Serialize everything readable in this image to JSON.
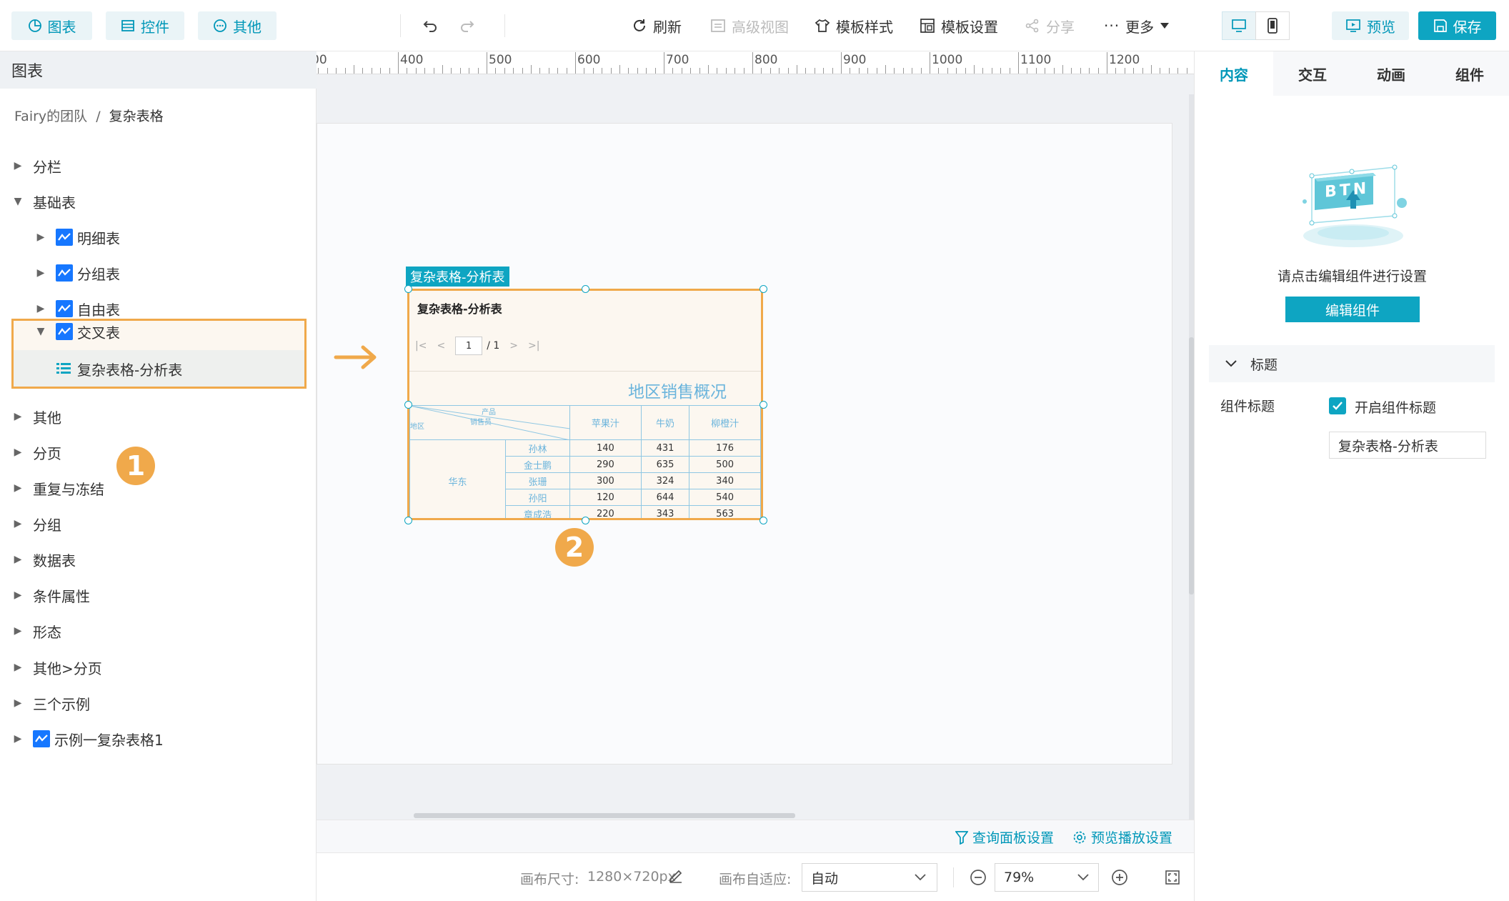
{
  "toolbar": {
    "tabs": [
      {
        "label": "图表",
        "icon": "chart-icon"
      },
      {
        "label": "控件",
        "icon": "widget-icon"
      },
      {
        "label": "其他",
        "icon": "more-circle-icon"
      }
    ],
    "refresh": "刷新",
    "advanced_view": "高级视图",
    "template_style": "模板样式",
    "template_settings": "模板设置",
    "share": "分享",
    "more": "更多",
    "preview": "预览",
    "save": "保存"
  },
  "left_panel": {
    "title": "图表",
    "breadcrumb": {
      "team": "Fairy的团队",
      "separator": "/",
      "current": "复杂表格"
    },
    "tree": [
      {
        "label": "分栏",
        "state": "collapsed"
      },
      {
        "label": "基础表",
        "state": "expanded"
      },
      {
        "label": "明细表",
        "state": "collapsed"
      },
      {
        "label": "分组表",
        "state": "collapsed"
      },
      {
        "label": "自由表",
        "state": "collapsed"
      },
      {
        "label": "交叉表",
        "state": "expanded"
      },
      {
        "label": "复杂表格-分析表",
        "state": "leaf"
      },
      {
        "label": "其他",
        "state": "collapsed"
      },
      {
        "label": "分页",
        "state": "collapsed"
      },
      {
        "label": "重复与冻结",
        "state": "collapsed"
      },
      {
        "label": "分组",
        "state": "collapsed"
      },
      {
        "label": "数据表",
        "state": "collapsed"
      },
      {
        "label": "条件属性",
        "state": "collapsed"
      },
      {
        "label": "形态",
        "state": "collapsed"
      },
      {
        "label": "其他>分页",
        "state": "collapsed"
      },
      {
        "label": "三个示例",
        "state": "collapsed"
      },
      {
        "label": "示例一复杂表格1",
        "state": "collapsed"
      }
    ]
  },
  "ruler": {
    "labels": [
      "00",
      "400",
      "500",
      "600",
      "700",
      "800",
      "900",
      "1000",
      "1100",
      "1200"
    ]
  },
  "annotations": {
    "badge1": "1",
    "badge2": "2"
  },
  "widget": {
    "label": "复杂表格-分析表",
    "title": "复杂表格-分析表",
    "pager": {
      "page": "1",
      "total": "/ 1"
    },
    "report_title": "地区销售概况",
    "corner": {
      "product": "产品",
      "salesperson": "销售员",
      "region": "地区"
    },
    "columns": [
      "苹果汁",
      "牛奶",
      "柳橙汁"
    ],
    "region": "华东",
    "rows": [
      {
        "name": "孙林",
        "values": [
          "140",
          "431",
          "176"
        ]
      },
      {
        "name": "金士鹏",
        "values": [
          "290",
          "635",
          "500"
        ]
      },
      {
        "name": "张珊",
        "values": [
          "300",
          "324",
          "340"
        ]
      },
      {
        "name": "孙阳",
        "values": [
          "120",
          "644",
          "540"
        ]
      },
      {
        "name": "章成浩",
        "values": [
          "220",
          "343",
          "563"
        ]
      }
    ]
  },
  "bottom": {
    "query_panel": "查询面板设置",
    "preview_play": "预览播放设置",
    "canvas_size_label": "画布尺寸:",
    "canvas_size_value": "1280×720px",
    "canvas_fit_label": "画布自适应:",
    "canvas_fit_value": "自动",
    "zoom": "79%"
  },
  "right_panel": {
    "tabs": [
      "内容",
      "交互",
      "动画",
      "组件"
    ],
    "active_tab": "内容",
    "illustration_text": "BTN",
    "hint": "请点击编辑组件进行设置",
    "edit_button": "编辑组件",
    "section_title": "标题",
    "field_label": "组件标题",
    "checkbox_label": "开启组件标题",
    "checkbox_checked": true,
    "title_input_value": "复杂表格-分析表"
  },
  "colors": {
    "accent": "#0ea5c2",
    "highlight": "#f0a94b",
    "tree_icon": "#1677ff"
  }
}
